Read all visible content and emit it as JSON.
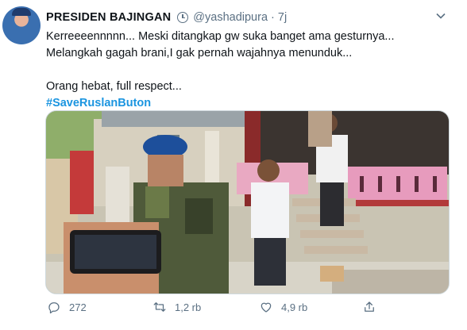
{
  "tweet": {
    "author_name": "PRESIDEN BAJINGAN",
    "author_handle": "@yashadipura",
    "separator": "·",
    "time": "7j",
    "lines": [
      "Kerreeeennnnn... Meski ditangkap gw suka banget ama gesturnya...",
      "Melangkah gagah brani,I gak pernah wajahnya menunduk...",
      "Orang hebat, full respect..."
    ],
    "hashtag": "#SaveRuslanButon",
    "media_icon": "photo",
    "actions": {
      "reply_count": "272",
      "retweet_count": "1,2 rb",
      "like_count": "4,9 rb"
    },
    "colors": {
      "text": "#0f1419",
      "secondary": "#5b7083",
      "link": "#1b95e0"
    }
  }
}
